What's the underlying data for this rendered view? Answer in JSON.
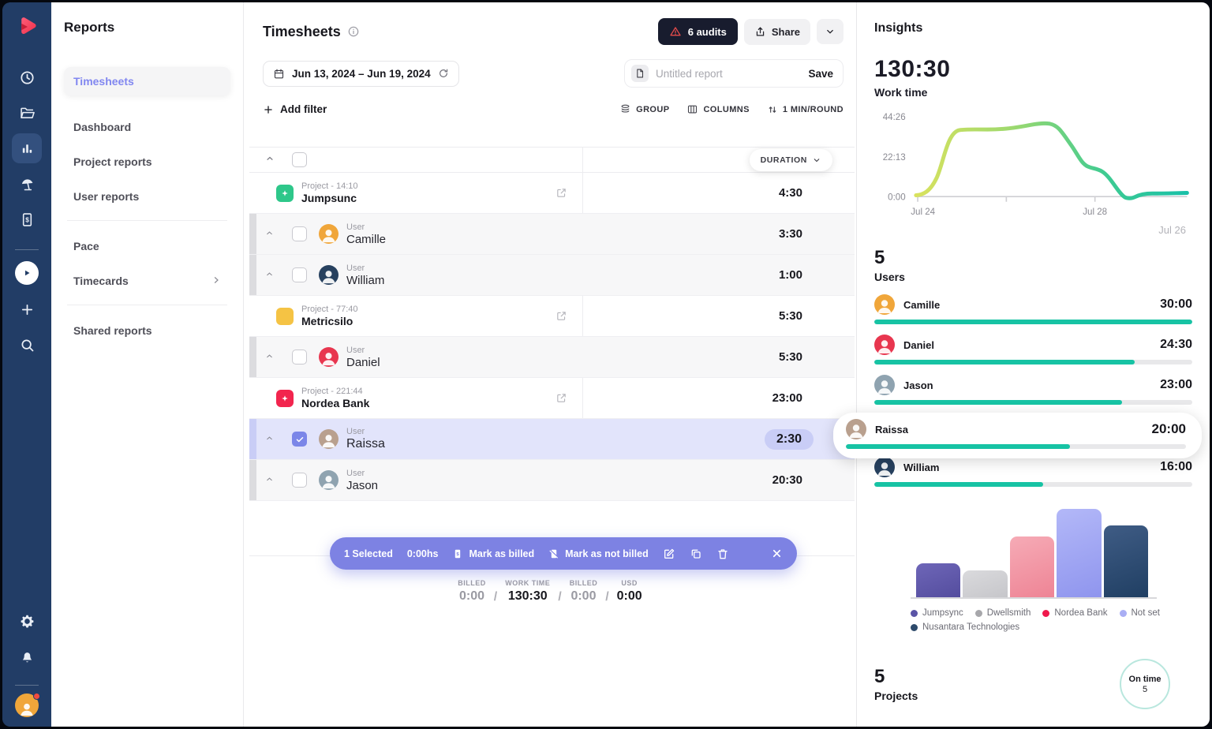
{
  "rail": {
    "icons": [
      "logo",
      "time-tracking",
      "projects",
      "reports",
      "time-off",
      "invoices",
      "start-timer",
      "add",
      "search",
      "settings",
      "notifications",
      "profile"
    ]
  },
  "sidebar": {
    "title": "Reports",
    "items": [
      {
        "label": "Timesheets"
      },
      {
        "label": "Dashboard"
      },
      {
        "label": "Project reports"
      },
      {
        "label": "User reports"
      },
      {
        "label": "Pace"
      },
      {
        "label": "Timecards"
      },
      {
        "label": "Shared reports"
      }
    ]
  },
  "header": {
    "title": "Timesheets",
    "audits_label": "6 audits",
    "share_label": "Share",
    "date_range": "Jun 13, 2024 – Jun 19, 2024",
    "report_placeholder": "Untitled report",
    "save_label": "Save",
    "add_filter_label": "Add filter",
    "group_label": "GROUP",
    "columns_label": "COLUMNS",
    "round_label": "1 MIN/ROUND",
    "duration_col": "DURATION"
  },
  "table": {
    "rows": [
      {
        "kind": "project",
        "sub": "Project - 14:10",
        "name": "Jumpsunc",
        "duration": "4:30",
        "color": "#2ec78a",
        "star": true
      },
      {
        "kind": "user",
        "sub": "User",
        "name": "Camille",
        "duration": "3:30",
        "avatar_color": "#f0a63a"
      },
      {
        "kind": "user",
        "sub": "User",
        "name": "William",
        "duration": "1:00",
        "avatar_color": "#27415f"
      },
      {
        "kind": "project",
        "sub": "Project - 77:40",
        "name": "Metricsilo",
        "duration": "5:30",
        "color": "#f5c344",
        "star": false
      },
      {
        "kind": "user",
        "sub": "User",
        "name": "Daniel",
        "duration": "5:30",
        "avatar_color": "#e8364f"
      },
      {
        "kind": "project",
        "sub": "Project - 221:44",
        "name": "Nordea Bank",
        "duration": "23:00",
        "color": "#f2254e",
        "star": true
      },
      {
        "kind": "user",
        "sub": "User",
        "name": "Raissa",
        "duration": "2:30",
        "avatar_color": "#b9a08e",
        "selected": true
      },
      {
        "kind": "user",
        "sub": "User",
        "name": "Jason",
        "duration": "20:30",
        "avatar_color": "#8fa3b0"
      }
    ]
  },
  "action_bar": {
    "selected_label": "1 Selected",
    "hours_label": "0:00hs",
    "billed_label": "Mark as billed",
    "not_billed_label": "Mark as not billed"
  },
  "summary": {
    "items": [
      {
        "label": "BILLED",
        "value": "0:00"
      },
      {
        "label": "WORK TIME",
        "value": "130:30"
      },
      {
        "label": "BILLED",
        "value": "0:00"
      },
      {
        "label": "USD",
        "value": "0:00"
      }
    ]
  },
  "insights": {
    "title": "Insights",
    "work_time": {
      "value": "130:30",
      "label": "Work time"
    },
    "work_chart": {
      "type": "line",
      "y_ticks": [
        "44:26",
        "22:13",
        "0:00"
      ],
      "x_ticks": [
        "Jul 24",
        "Jul 28"
      ],
      "annotation": "Jul 26",
      "ylim_hours": [
        0,
        44.43
      ],
      "series_hours": [
        1,
        5,
        18,
        37,
        37,
        37,
        38,
        41,
        40,
        32,
        20,
        16,
        15,
        10,
        0,
        1.5,
        1.5,
        1.7
      ]
    },
    "users": {
      "count": "5",
      "label": "Users",
      "list": [
        {
          "name": "Camille",
          "time": "30:00",
          "pct": "100%"
        },
        {
          "name": "Daniel",
          "time": "24:30",
          "pct": "82%"
        },
        {
          "name": "Jason",
          "time": "23:00",
          "pct": "78%"
        },
        {
          "name": "Raissa",
          "time": "20:00",
          "pct": "66%",
          "highlight": true
        },
        {
          "name": "William",
          "time": "16:00",
          "pct": "53%"
        }
      ]
    },
    "project_chart": {
      "type": "bar",
      "categories": [
        "Jumpsync",
        "Dwellsmith",
        "Nordea Bank",
        "Not set",
        "Nusantara Technologies"
      ],
      "values": [
        38,
        30,
        68,
        100,
        81
      ],
      "heights": [
        "43px",
        "34px",
        "77px",
        "112px",
        "91px"
      ]
    },
    "legend": [
      {
        "label": "Jumpsync",
        "color": "#5a54a6"
      },
      {
        "label": "Dwellsmith",
        "color": "#a7a7ab"
      },
      {
        "label": "Nordea Bank",
        "color": "#f0194c"
      },
      {
        "label": "Not set",
        "color": "#a9aef4"
      },
      {
        "label": "Nusantara Technologies",
        "color": "#2e4a6b"
      }
    ],
    "projects": {
      "count": "5",
      "label": "Projects"
    },
    "on_time": {
      "label": "On time",
      "value": "5"
    }
  },
  "avatar_colors": {
    "camille": "#f0a63a",
    "daniel": "#e8364f",
    "jason": "#8fa3b0",
    "raissa": "#b9a08e",
    "william": "#27415f"
  }
}
